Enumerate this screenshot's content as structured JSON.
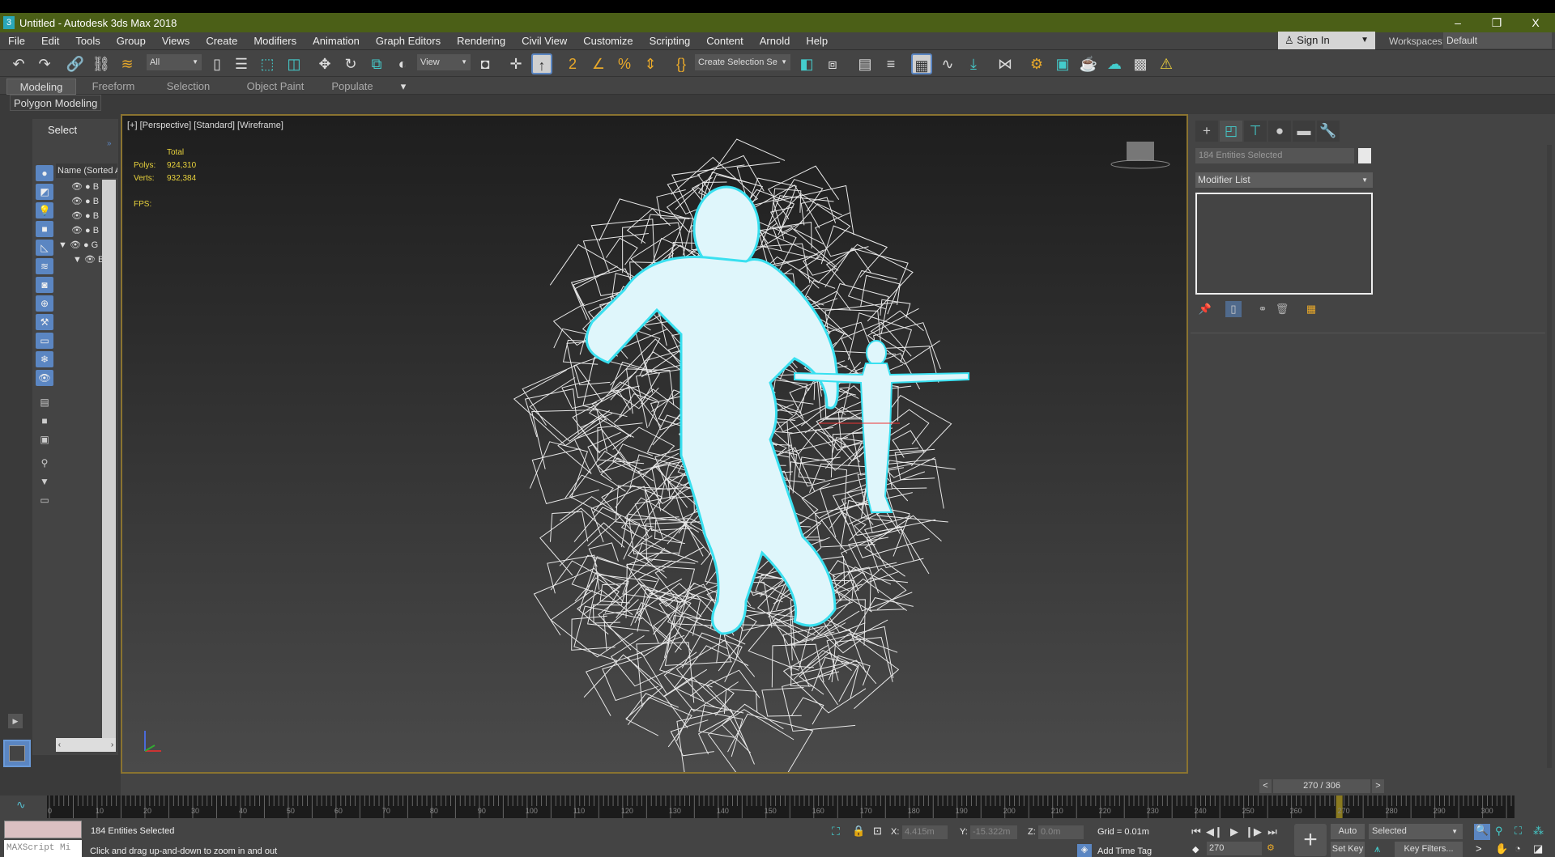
{
  "window": {
    "title": "Untitled - Autodesk 3ds Max 2018",
    "app_icon": "3",
    "minimize": "–",
    "restore": "❐",
    "close": "X"
  },
  "menu": [
    "File",
    "Edit",
    "Tools",
    "Group",
    "Views",
    "Create",
    "Modifiers",
    "Animation",
    "Graph Editors",
    "Rendering",
    "Civil View",
    "Customize",
    "Scripting",
    "Content",
    "Arnold",
    "Help"
  ],
  "account": {
    "sign_in": "Sign In",
    "workspaces_label": "Workspaces:",
    "workspace": "Default"
  },
  "toolbar": {
    "filter": "All",
    "ref_coord": "View",
    "selection_set": "Create Selection Se"
  },
  "ribbon": {
    "tabs": [
      "Modeling",
      "Freeform",
      "Selection",
      "Object Paint",
      "Populate"
    ],
    "active_tab": "Modeling",
    "panel": "Polygon Modeling"
  },
  "explorer": {
    "title": "Select",
    "column": "Name (Sorted Ascending)",
    "rows": [
      "B",
      "B",
      "B",
      "B",
      "G",
      "B"
    ]
  },
  "viewport": {
    "label": "[+] [Perspective] [Standard] [Wireframe]",
    "stats": {
      "total_label": "Total",
      "polys_label": "Polys:",
      "polys": "924,310",
      "verts_label": "Verts:",
      "verts": "932,384",
      "fps_label": "FPS:"
    }
  },
  "command_panel": {
    "selection_name": "184 Entities Selected",
    "modifier_list": "Modifier List"
  },
  "timeline": {
    "slider": "270 / 306",
    "prev": "<",
    "next": ">",
    "current_frame": 270,
    "total_frames": 306,
    "ticks": [
      0,
      10,
      20,
      30,
      40,
      50,
      60,
      70,
      80,
      90,
      100,
      110,
      120,
      130,
      140,
      150,
      160,
      170,
      180,
      190,
      200,
      210,
      220,
      230,
      240,
      250,
      260,
      270,
      280,
      290,
      300
    ]
  },
  "status": {
    "maxscript": "MAXScript Mi",
    "selection": "184 Entities Selected",
    "prompt": "Click and drag up-and-down to zoom in and out",
    "x_label": "X:",
    "x": "4.415m",
    "y_label": "Y:",
    "y": "-15.322m",
    "z_label": "Z:",
    "z": "0.0m",
    "grid": "Grid = 0.01m",
    "add_time_tag": "Add Time Tag",
    "frame": "270",
    "auto_key": "Auto Key",
    "set_key": "Set Key",
    "key_mode": "Selected",
    "key_filters": "Key Filters..."
  },
  "colors": {
    "titlebar": "#4b5f17",
    "accent": "#5b86c2",
    "stats": "#e8d23c",
    "selection": "#39e0f0"
  }
}
